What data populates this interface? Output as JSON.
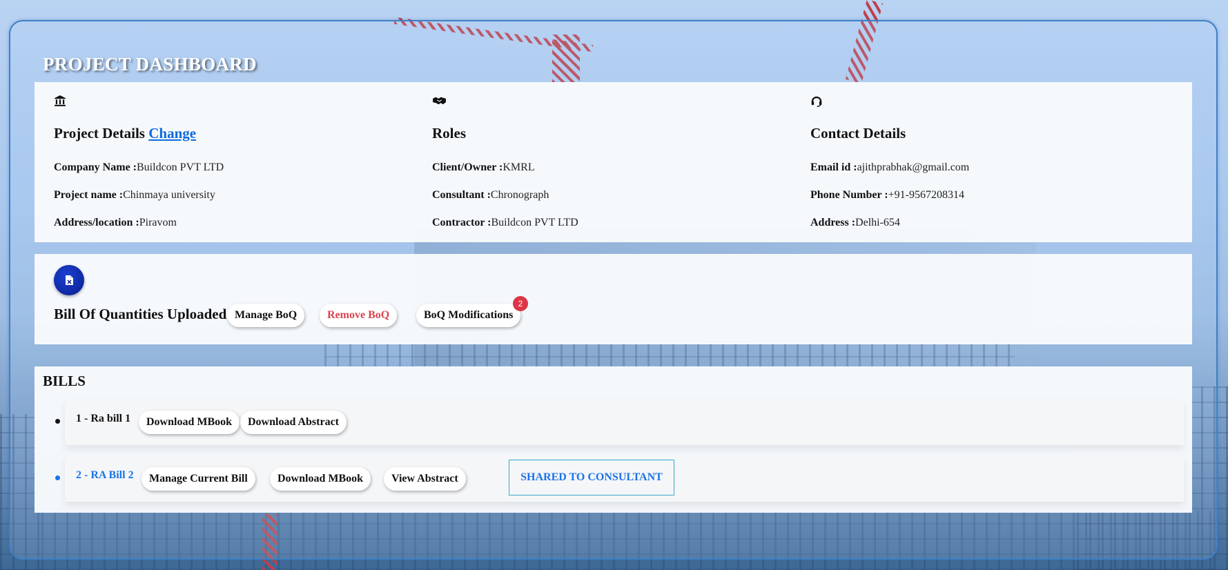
{
  "dashboard": {
    "title": "PROJECT DASHBOARD"
  },
  "project_details": {
    "heading": "Project Details",
    "change_link": "Change",
    "fields": [
      {
        "label": "Company Name :",
        "value": "Buildcon PVT LTD"
      },
      {
        "label": "Project name :",
        "value": "Chinmaya university"
      },
      {
        "label": "Address/location :",
        "value": "Piravom"
      }
    ]
  },
  "roles": {
    "heading": "Roles",
    "fields": [
      {
        "label": "Client/Owner :",
        "value": "KMRL"
      },
      {
        "label": "Consultant :",
        "value": "Chronograph"
      },
      {
        "label": "Contractor :",
        "value": "Buildcon PVT LTD"
      }
    ]
  },
  "contact_details": {
    "heading": "Contact Details",
    "fields": [
      {
        "label": "Email id :",
        "value": "ajithprabhak@gmail.com"
      },
      {
        "label": "Phone Number :",
        "value": "+91-9567208314"
      },
      {
        "label": "Address :",
        "value": "Delhi-654"
      }
    ]
  },
  "icons": {
    "project": "bank-icon",
    "roles": "handshake-icon",
    "contact": "headset-icon",
    "boq": "excel-file-icon"
  },
  "boq": {
    "title": "Bill Of Quantities Uploaded",
    "manage_label": "Manage BoQ",
    "remove_label": "Remove BoQ",
    "modifications_label": "BoQ Modifications",
    "modifications_count": "2"
  },
  "bills": {
    "title": "BILLS",
    "items": [
      {
        "label": "1 - Ra bill 1",
        "actions": [
          "Download MBook",
          "Download Abstract"
        ]
      },
      {
        "label": "2 - RA Bill 2",
        "actions": [
          "Manage Current Bill",
          "Download MBook",
          "View Abstract"
        ],
        "status": "SHARED TO CONSULTANT"
      }
    ]
  },
  "colors": {
    "link": "#0b6be0",
    "danger": "#d9434f",
    "badge": "#dc3545",
    "active_bill": "#1a73e8",
    "border": "#3f7fc6"
  }
}
